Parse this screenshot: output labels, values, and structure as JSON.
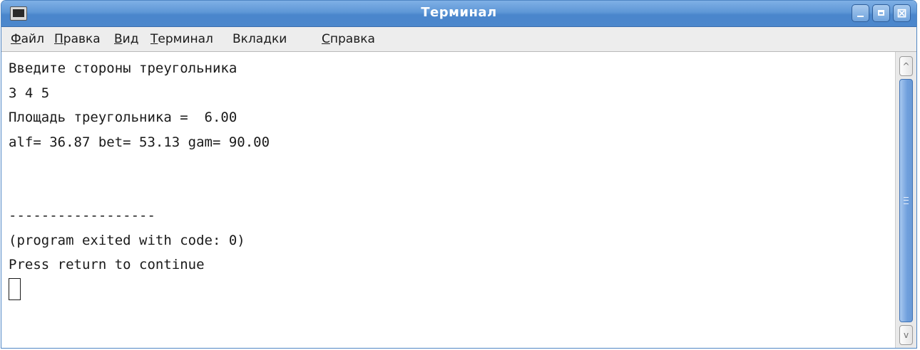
{
  "window": {
    "title": "Терминал",
    "icon": "terminal-icon",
    "buttons": {
      "minimize": "minimize-icon",
      "maximize": "maximize-icon",
      "close_glyph": "⊠"
    },
    "accent_color": "#5e97d6"
  },
  "menu": {
    "items": [
      {
        "first": "Ф",
        "rest": "айл"
      },
      {
        "first": "П",
        "rest": "равка"
      },
      {
        "first": "В",
        "rest": "ид"
      },
      {
        "first": "Т",
        "rest": "ерминал"
      },
      {
        "first": "",
        "rest": "Вкладки"
      },
      {
        "first": "С",
        "rest": "правка"
      }
    ]
  },
  "terminal": {
    "lines": [
      "Введите стороны треугольника",
      "3 4 5",
      "Площадь треугольника =  6.00",
      "alf= 36.87 bet= 53.13 gam= 90.00",
      "",
      "",
      "------------------",
      "(program exited with code: 0)",
      "Press return to continue"
    ]
  },
  "scrollbar": {
    "up_glyph": "^",
    "down_glyph": "v"
  }
}
